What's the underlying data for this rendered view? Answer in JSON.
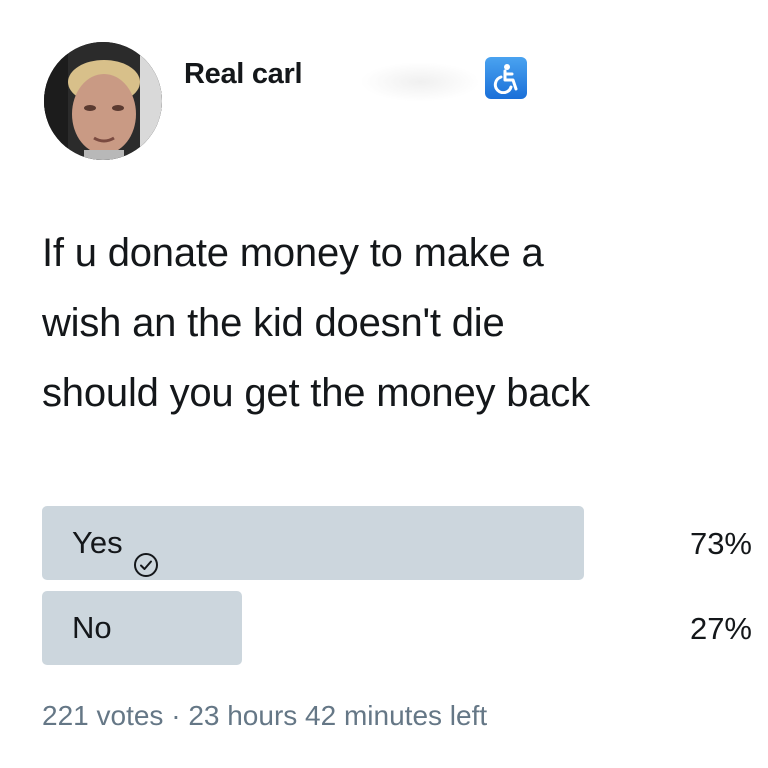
{
  "user": {
    "display_name": "Real carl",
    "badge_icon": "wheelchair-accessibility-icon"
  },
  "tweet": {
    "text": "If u donate money to make a\nwish an the kid doesn't die\nshould you get the money back"
  },
  "poll": {
    "options": [
      {
        "label": "Yes",
        "percent_label": "73%",
        "percent": 73,
        "selected": true
      },
      {
        "label": "No",
        "percent_label": "27%",
        "percent": 27,
        "selected": false
      }
    ],
    "votes_label": "221 votes",
    "separator": "·",
    "time_left_label": "23 hours 42 minutes left"
  },
  "colors": {
    "bar": "#ccd6dd",
    "meta_text": "#657786",
    "badge": "#1d77e0"
  }
}
